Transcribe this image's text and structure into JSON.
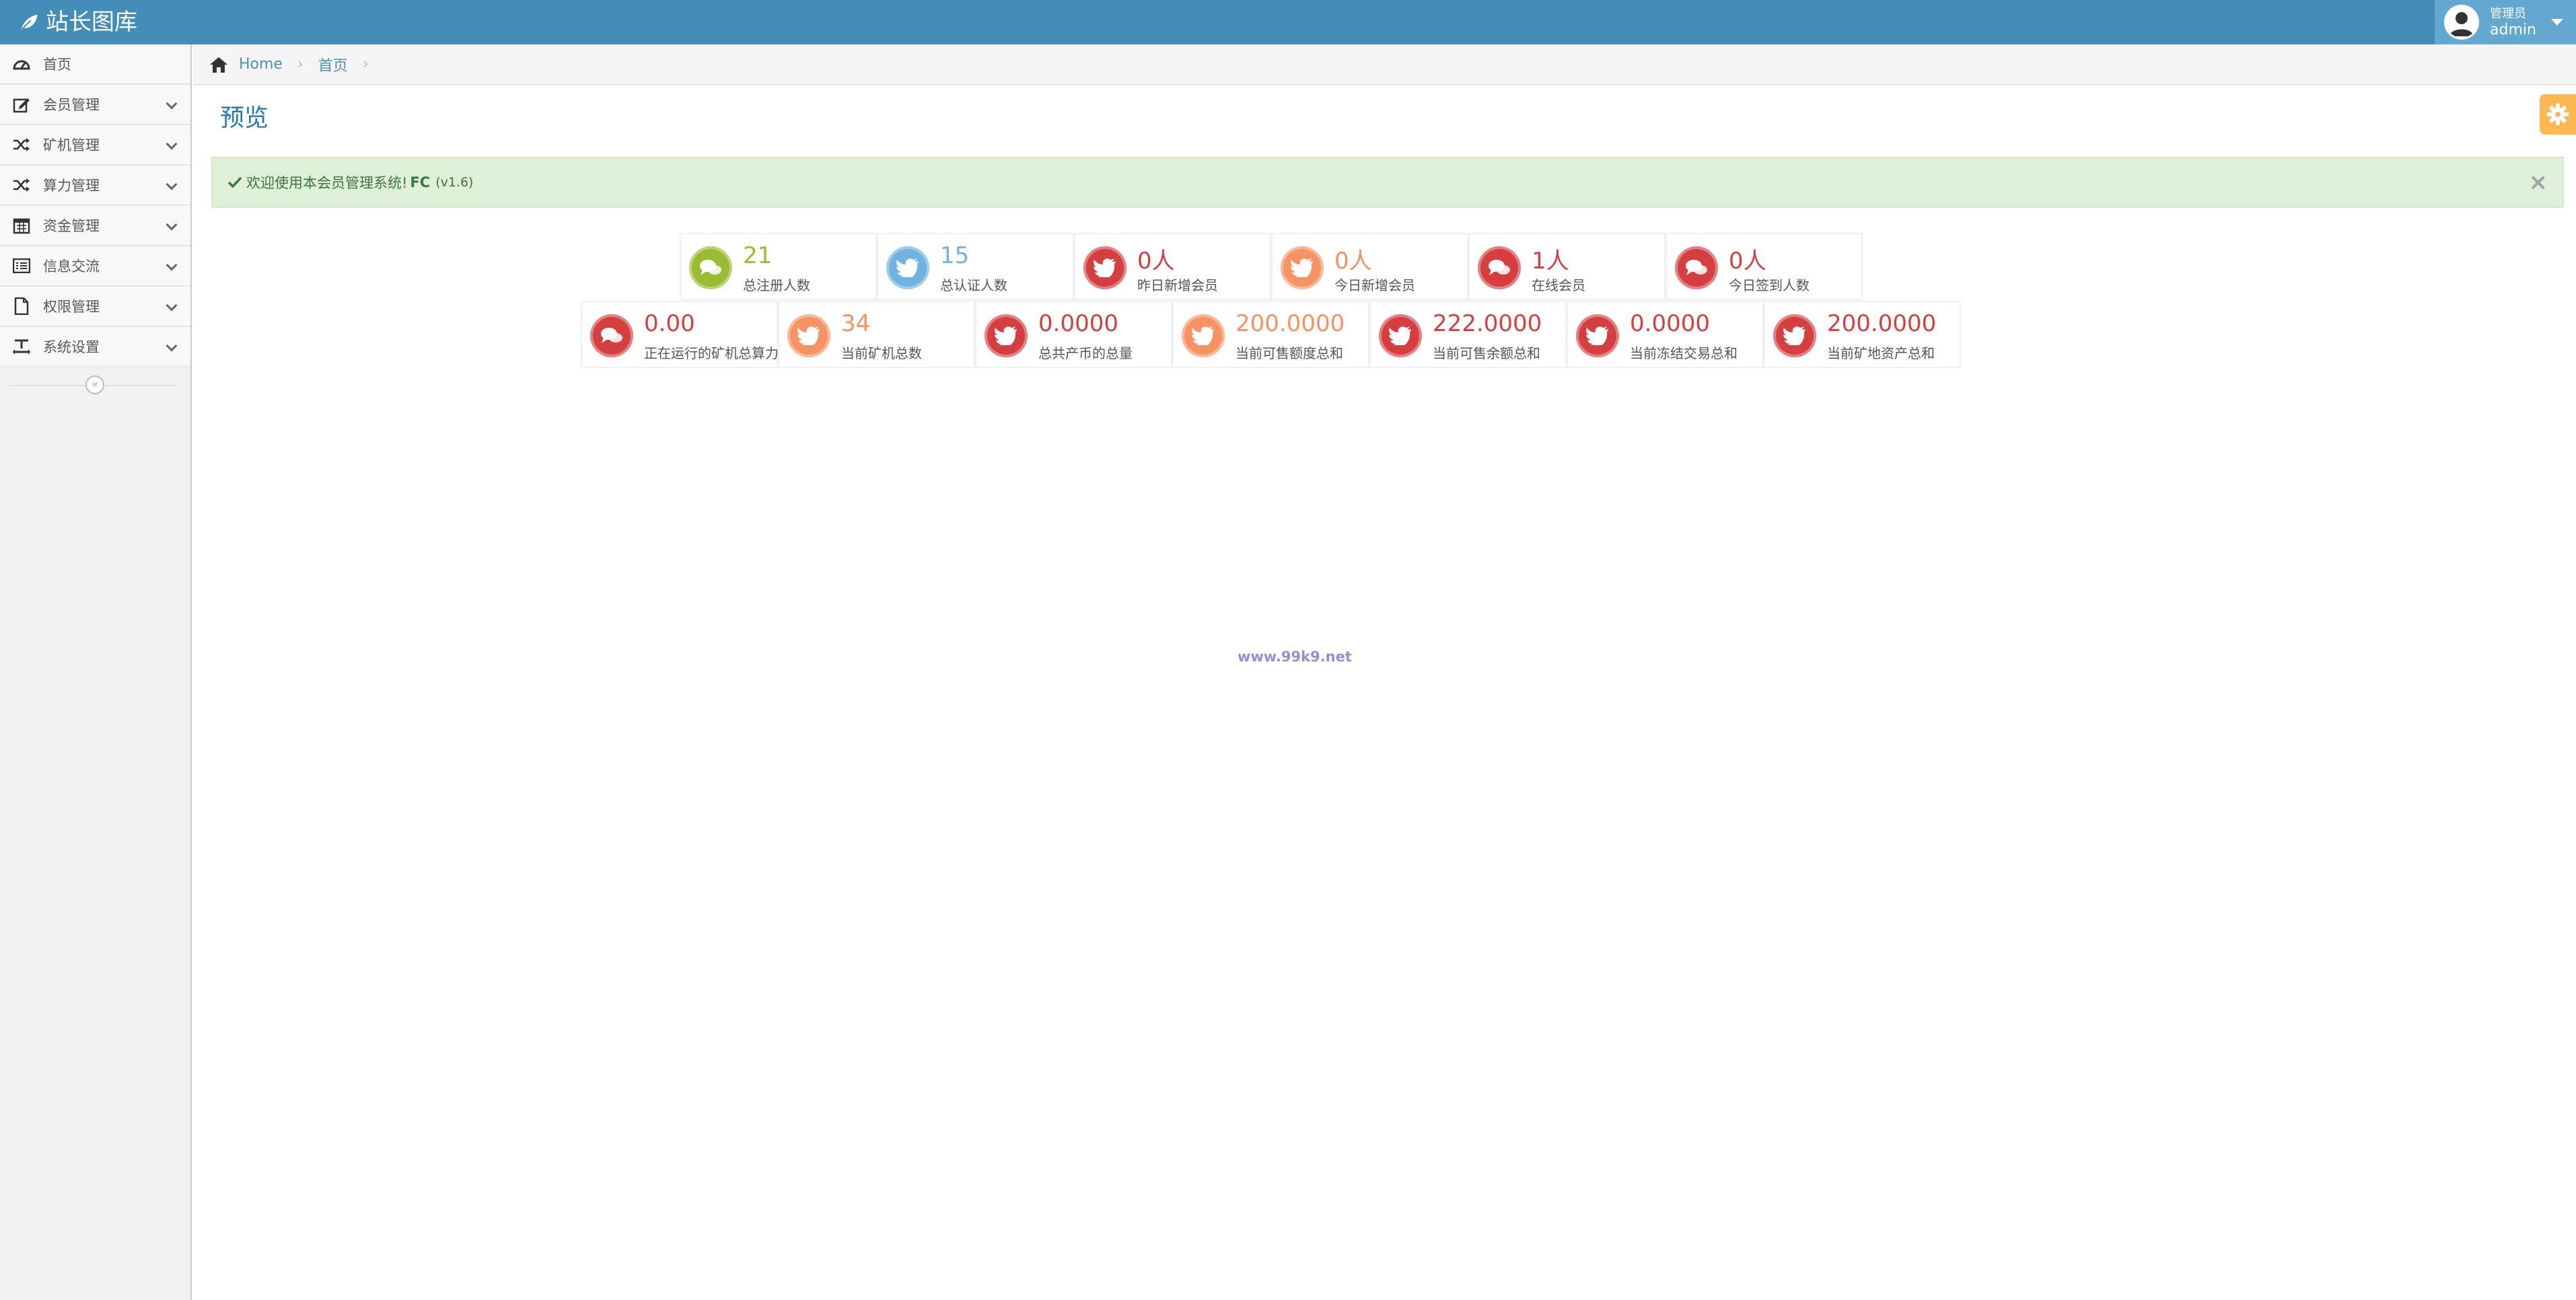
{
  "brand": {
    "title": "站长图库"
  },
  "user": {
    "role": "管理员",
    "name": "admin"
  },
  "sidebar": {
    "items": [
      {
        "label": "首页",
        "icon": "dashboard-icon",
        "has_children": false
      },
      {
        "label": "会员管理",
        "icon": "edit-icon",
        "has_children": true
      },
      {
        "label": "矿机管理",
        "icon": "shuffle-icon",
        "has_children": true
      },
      {
        "label": "算力管理",
        "icon": "shuffle-icon",
        "has_children": true
      },
      {
        "label": "资金管理",
        "icon": "calendar-icon",
        "has_children": true
      },
      {
        "label": "信息交流",
        "icon": "list-icon",
        "has_children": true
      },
      {
        "label": "权限管理",
        "icon": "file-icon",
        "has_children": true
      },
      {
        "label": "系统设置",
        "icon": "text-width-icon",
        "has_children": true
      }
    ],
    "collapse_glyph": "«"
  },
  "breadcrumbs": {
    "home": "Home",
    "current": "首页",
    "separator": "›"
  },
  "page": {
    "title": "预览"
  },
  "alert": {
    "message": "欢迎使用本会员管理系统!",
    "product": "FC",
    "version": "(v1.6)",
    "close": "×"
  },
  "stats_row1": [
    {
      "value": "21",
      "label": "总注册人数",
      "color": "#9abc32",
      "icon": "comments-icon"
    },
    {
      "value": "15",
      "label": "总认证人数",
      "color": "#6fb3e0",
      "icon": "twitter-icon"
    },
    {
      "value": "0人",
      "label": "昨日新增会员",
      "color": "#d53f40",
      "icon": "twitter-icon"
    },
    {
      "value": "0人",
      "label": "今日新增会员",
      "color": "#f79263",
      "icon": "twitter-icon"
    },
    {
      "value": "1人",
      "label": "在线会员",
      "color": "#d53f40",
      "icon": "comments-icon"
    },
    {
      "value": "0人",
      "label": "今日签到人数",
      "color": "#d53f40",
      "icon": "comments-icon"
    }
  ],
  "stats_row2": [
    {
      "value": "0.00",
      "label": "正在运行的矿机总算力",
      "color": "#d53f40",
      "icon": "comments-icon"
    },
    {
      "value": "34",
      "label": "当前矿机总数",
      "color": "#f79263",
      "icon": "twitter-icon"
    },
    {
      "value": "0.0000",
      "label": "总共产币的总量",
      "color": "#d53f40",
      "icon": "twitter-icon"
    },
    {
      "value": "200.0000",
      "label": "当前可售额度总和",
      "color": "#f79263",
      "icon": "twitter-icon"
    },
    {
      "value": "222.0000",
      "label": "当前可售余额总和",
      "color": "#d53f40",
      "icon": "twitter-icon"
    },
    {
      "value": "0.0000",
      "label": "当前冻结交易总和",
      "color": "#d53f40",
      "icon": "twitter-icon"
    },
    {
      "value": "200.0000",
      "label": "当前矿地资产总和",
      "color": "#d53f40",
      "icon": "twitter-icon"
    }
  ],
  "watermark": "www.99k9.net",
  "colors": {
    "navbar": "#438eb9",
    "accent": "#2679b5",
    "alert_bg": "#dff0d8"
  }
}
